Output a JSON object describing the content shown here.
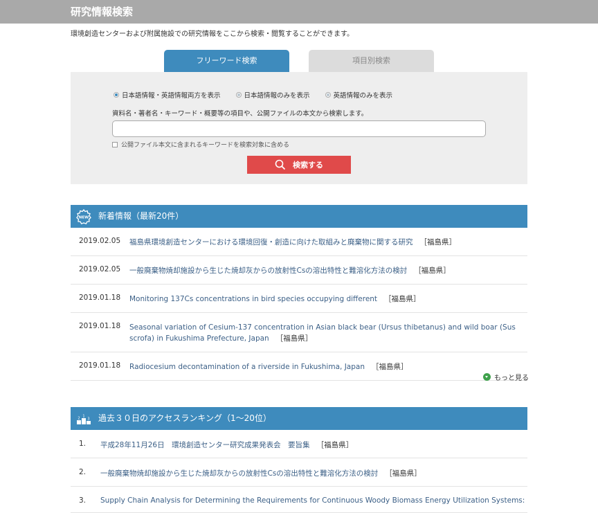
{
  "header": {
    "title": "研究情報検索"
  },
  "intro": "環境創造センターおよび附属施設での研究情報をここから検索・閲覧することができます。",
  "tabs": {
    "free": "フリーワード検索",
    "item": "項目別検索"
  },
  "search": {
    "radios": [
      "日本語情報・英語情報両方を表示",
      "日本語情報のみを表示",
      "英語情報のみを表示"
    ],
    "description": "資料名・著者名・キーワード・概要等の項目や、公開ファイルの本文から検索します。",
    "input_value": "",
    "checkbox_label": "公開ファイル本文に含まれるキーワードを検索対象に含める",
    "button_label": "検索する"
  },
  "news": {
    "header": "新着情報（最新20件）",
    "icon_text": "NEW",
    "items": [
      {
        "date": "2019.02.05",
        "title": "福島県環境創造センターにおける環境回復・創造に向けた取組みと廃棄物に関する研究",
        "pref": "［福島県］"
      },
      {
        "date": "2019.02.05",
        "title": "一般廃棄物焼却施設から生じた焼却灰からの放射性Csの溶出特性と難溶化方法の検討",
        "pref": "［福島県］"
      },
      {
        "date": "2019.01.18",
        "title": "Monitoring 137Cs concentrations in bird species occupying different",
        "pref": "［福島県］"
      },
      {
        "date": "2019.01.18",
        "title": "Seasonal variation of Cesium-137 concentration in Asian black bear (Ursus thibetanus) and wild boar (Sus scrofa) in Fukushima Prefecture, Japan",
        "pref": "［福島県］"
      },
      {
        "date": "2019.01.18",
        "title": "Radiocesium decontamination of a riverside in Fukushima, Japan",
        "pref": "［福島県］"
      }
    ],
    "more": "もっと見る"
  },
  "ranking": {
    "header": "過去３０日のアクセスランキング（1〜20位）",
    "icon_text": "2 1 3",
    "items": [
      {
        "num": "1.",
        "title": "平成28年11月26日　環境創造センター研究成果発表会　要旨集",
        "pref": "［福島県］"
      },
      {
        "num": "2.",
        "title": "一般廃棄物焼却施設から生じた焼却灰からの放射性Csの溶出特性と難溶化方法の検討",
        "pref": "［福島県］"
      },
      {
        "num": "3.",
        "title": "Supply Chain Analysis for Determining the Requirements for Continuous Woody Biomass Energy Utilization Systems:",
        "pref": ""
      }
    ]
  }
}
